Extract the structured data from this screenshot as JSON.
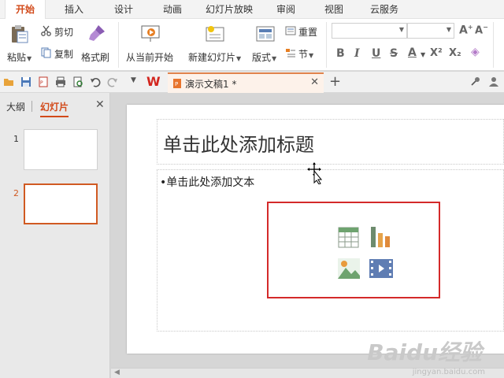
{
  "menu": {
    "tabs": [
      "开始",
      "插入",
      "设计",
      "动画",
      "幻灯片放映",
      "审阅",
      "视图",
      "云服务"
    ],
    "active": "开始"
  },
  "ribbon": {
    "paste": "粘贴",
    "cut": "剪切",
    "copy": "复制",
    "format_painter": "格式刷",
    "from_current": "从当前开始",
    "new_slide": "新建幻灯片",
    "layout": "版式",
    "reset": "重置",
    "section": "节",
    "format_buttons": [
      "B",
      "I",
      "U",
      "S",
      "A",
      "X²",
      "X₂"
    ]
  },
  "document": {
    "tab_title": "演示文稿1 *"
  },
  "outline": {
    "tab_outline": "大纲",
    "tab_slides": "幻灯片",
    "thumbnails": [
      {
        "num": "1"
      },
      {
        "num": "2"
      }
    ]
  },
  "slide": {
    "title_placeholder": "单击此处添加标题",
    "body_placeholder": "单击此处添加文本"
  },
  "watermark": {
    "brand": "Baidu经验",
    "url": "jingyan.baidu.com"
  },
  "colors": {
    "accent": "#d24a1a",
    "selection": "#d05a22",
    "highlight_box": "#d42a2a"
  }
}
